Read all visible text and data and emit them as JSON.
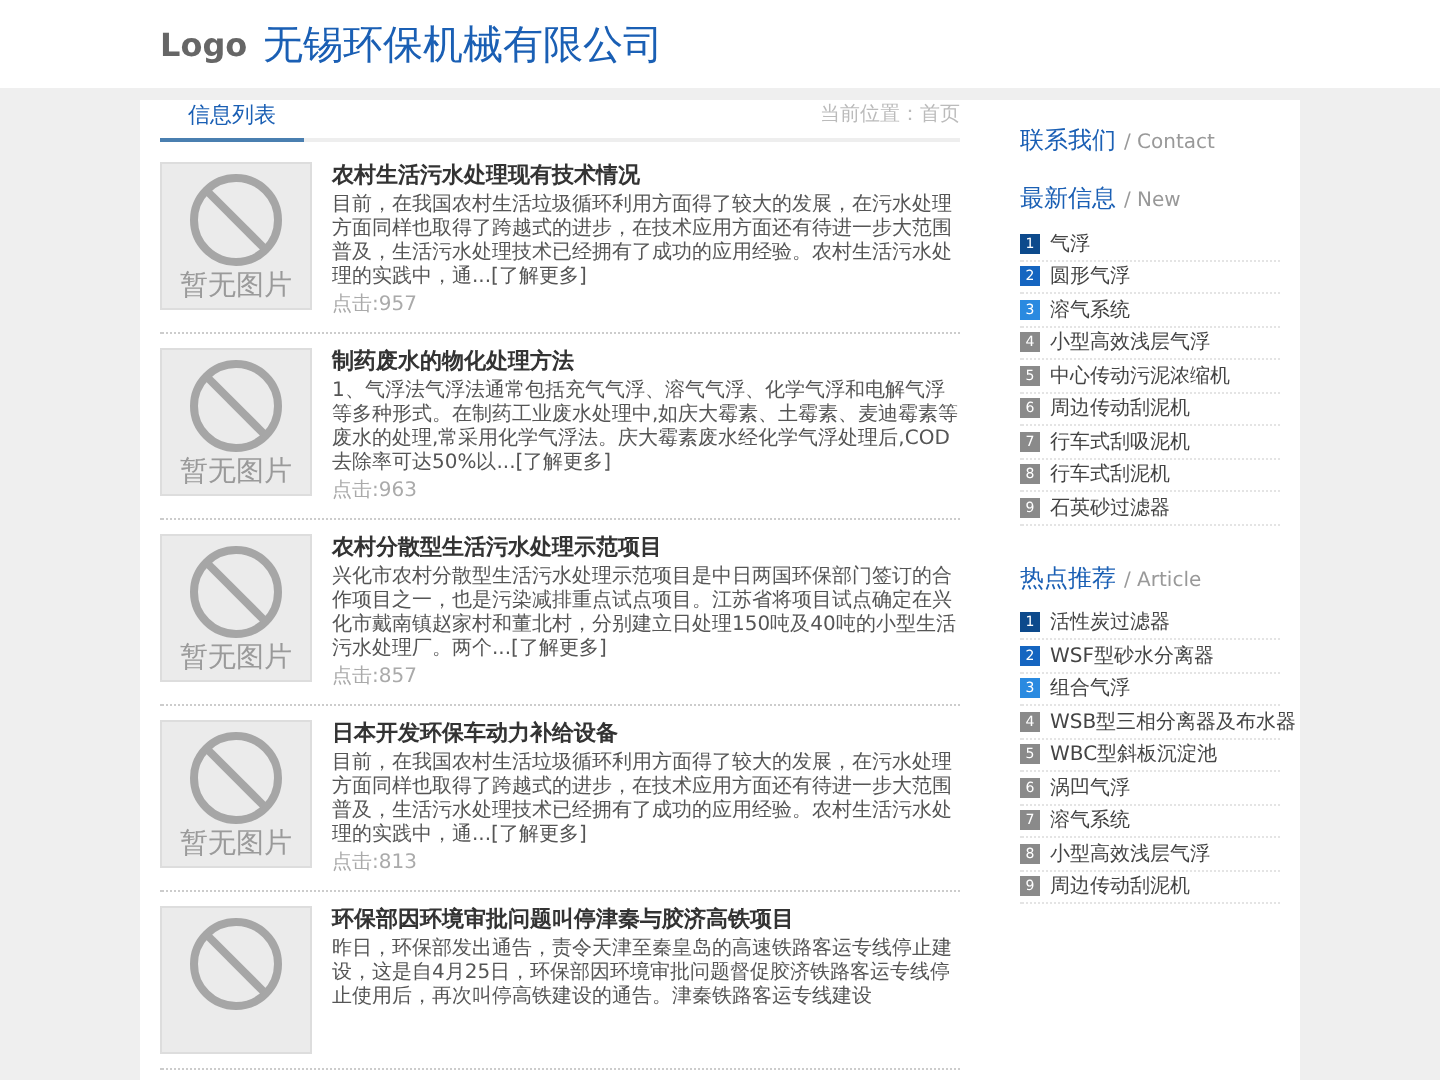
{
  "header": {
    "logo": "Logo",
    "company": "无锡环保机械有限公司"
  },
  "main": {
    "tab": "信息列表",
    "breadcrumb": "当前位置：首页",
    "articles": [
      {
        "image_text": "暂无图片",
        "title": "农村生活污水处理现有技术情况",
        "summary": "目前，在我国农村生活垃圾循环利用方面得了较大的发展，在污水处理方面同样也取得了跨越式的进步，在技术应用方面还有待进一步大范围普及，生活污水处理技术已经拥有了成功的应用经验。农村生活污水处理的实践中，通...[了解更多]",
        "clicks": "点击:957"
      },
      {
        "image_text": "暂无图片",
        "title": "制药废水的物化处理方法",
        "summary": "1、气浮法气浮法通常包括充气气浮、溶气气浮、化学气浮和电解气浮等多种形式。在制药工业废水处理中,如庆大霉素、土霉素、麦迪霉素等废水的处理,常采用化学气浮法。庆大霉素废水经化学气浮处理后,COD去除率可达50%以...[了解更多]",
        "clicks": "点击:963"
      },
      {
        "image_text": "暂无图片",
        "title": "农村分散型生活污水处理示范项目",
        "summary": "兴化市农村分散型生活污水处理示范项目是中日两国环保部门签订的合作项目之一，也是污染减排重点试点项目。江苏省将项目试点确定在兴化市戴南镇赵家村和董北村，分别建立日处理150吨及40吨的小型生活污水处理厂。两个...[了解更多]",
        "clicks": "点击:857"
      },
      {
        "image_text": "暂无图片",
        "title": "日本开发环保车动力补给设备",
        "summary": "目前，在我国农村生活垃圾循环利用方面得了较大的发展，在污水处理方面同样也取得了跨越式的进步，在技术应用方面还有待进一步大范围普及，生活污水处理技术已经拥有了成功的应用经验。农村生活污水处理的实践中，通...[了解更多]",
        "clicks": "点击:813"
      },
      {
        "title": "环保部因环境审批问题叫停津秦与胶济高铁项目",
        "summary": "昨日，环保部发出通告，责令天津至秦皇岛的高速铁路客运专线停止建设，这是自4月25日，环保部因环境审批问题督促胶济铁路客运专线停止使用后，再次叫停高铁建设的通告。津秦铁路客运专线建设"
      }
    ]
  },
  "sidebar": {
    "contact": {
      "title": "联系我们",
      "subtitle": "/ Contact"
    },
    "sections": [
      {
        "title": "最新信息",
        "subtitle": "/ New",
        "items": [
          {
            "num": "1",
            "label": "气浮",
            "color": "#0d4a8c"
          },
          {
            "num": "2",
            "label": "圆形气浮",
            "color": "#1565c0"
          },
          {
            "num": "3",
            "label": "溶气系统",
            "color": "#2a8ae0"
          },
          {
            "num": "4",
            "label": "小型高效浅层气浮",
            "color": "#8a8a8a"
          },
          {
            "num": "5",
            "label": "中心传动污泥浓缩机",
            "color": "#8a8a8a"
          },
          {
            "num": "6",
            "label": "周边传动刮泥机",
            "color": "#8a8a8a"
          },
          {
            "num": "7",
            "label": "行车式刮吸泥机",
            "color": "#8a8a8a"
          },
          {
            "num": "8",
            "label": "行车式刮泥机",
            "color": "#8a8a8a"
          },
          {
            "num": "9",
            "label": "石英砂过滤器",
            "color": "#8a8a8a"
          }
        ]
      },
      {
        "title": "热点推荐",
        "subtitle": "/ Article",
        "items": [
          {
            "num": "1",
            "label": "活性炭过滤器",
            "color": "#0d4a8c"
          },
          {
            "num": "2",
            "label": "WSF型砂水分离器",
            "color": "#1565c0"
          },
          {
            "num": "3",
            "label": "组合气浮",
            "color": "#2a8ae0"
          },
          {
            "num": "4",
            "label": "WSB型三相分离器及布水器",
            "color": "#8a8a8a"
          },
          {
            "num": "5",
            "label": "WBC型斜板沉淀池",
            "color": "#8a8a8a"
          },
          {
            "num": "6",
            "label": "涡凹气浮",
            "color": "#8a8a8a"
          },
          {
            "num": "7",
            "label": "溶气系统",
            "color": "#8a8a8a"
          },
          {
            "num": "8",
            "label": "小型高效浅层气浮",
            "color": "#8a8a8a"
          },
          {
            "num": "9",
            "label": "周边传动刮泥机",
            "color": "#8a8a8a"
          }
        ]
      }
    ]
  }
}
